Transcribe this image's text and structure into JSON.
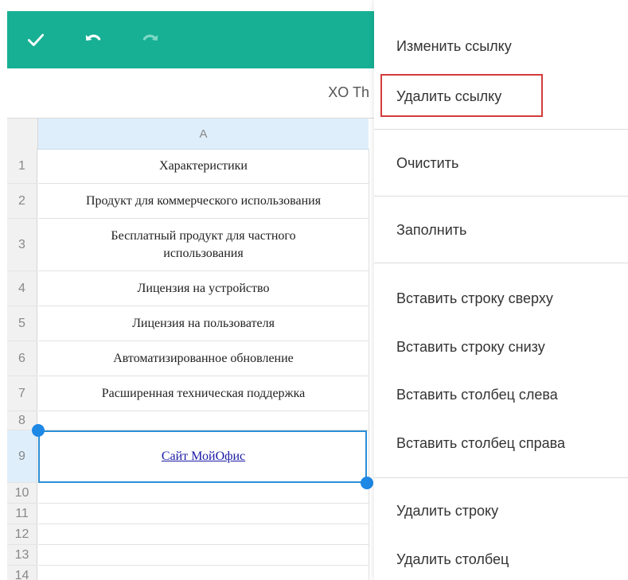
{
  "toolbar": {
    "icons": [
      "check-icon",
      "undo-icon",
      "redo-icon"
    ],
    "accent": "#17b094"
  },
  "document": {
    "title": "XO Th"
  },
  "sheet": {
    "column_header": "A",
    "rows": [
      {
        "num": "1",
        "text": "Характеристики"
      },
      {
        "num": "2",
        "text": "Продукт для коммерческого использования"
      },
      {
        "num": "3",
        "text": "Бесплатный продукт для частного использования"
      },
      {
        "num": "4",
        "text": "Лицензия на устройство"
      },
      {
        "num": "5",
        "text": "Лицензия на пользователя"
      },
      {
        "num": "6",
        "text": "Автоматизированное обновление"
      },
      {
        "num": "7",
        "text": "Расширенная техническая поддержка"
      },
      {
        "num": "8",
        "text": ""
      },
      {
        "num": "9",
        "text": "Сайт МойОфис"
      },
      {
        "num": "10",
        "text": ""
      },
      {
        "num": "11",
        "text": ""
      },
      {
        "num": "12",
        "text": ""
      },
      {
        "num": "13",
        "text": ""
      },
      {
        "num": "14",
        "text": ""
      }
    ],
    "selection_color": "#2a8fd6"
  },
  "context_menu": {
    "items": [
      "Изменить ссылку",
      "Удалить ссылку",
      "Очистить",
      "Заполнить",
      "Вставить строку сверху",
      "Вставить строку снизу",
      "Вставить столбец слева",
      "Вставить столбец справа",
      "Удалить строку",
      "Удалить столбец"
    ],
    "highlighted": "Удалить ссылку",
    "highlight_color": "#d23c3c"
  }
}
